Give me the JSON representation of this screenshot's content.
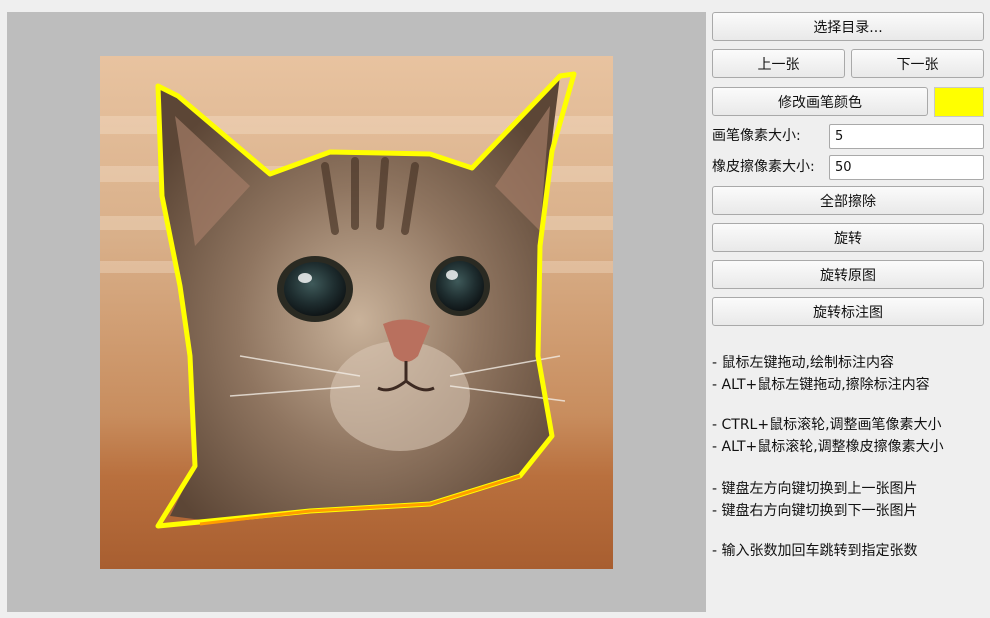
{
  "buttons": {
    "select_dir": "选择目录...",
    "prev": "上一张",
    "next": "下一张",
    "change_pen_color": "修改画笔颜色",
    "clear_all": "全部擦除",
    "rotate": "旋转",
    "rotate_original": "旋转原图",
    "rotate_annotation": "旋转标注图"
  },
  "pen_color": "#ffff00",
  "fields": {
    "pen_size_label": "画笔像素大小:",
    "pen_size_value": "5",
    "eraser_size_label": "橡皮擦像素大小:",
    "eraser_size_value": "50"
  },
  "help": {
    "line1": "- 鼠标左键拖动,绘制标注内容",
    "line2": "- ALT+鼠标左键拖动,擦除标注内容",
    "line3": "- CTRL+鼠标滚轮,调整画笔像素大小",
    "line4": "- ALT+鼠标滚轮,调整橡皮擦像素大小",
    "line5": "- 键盘左方向键切换到上一张图片",
    "line6": "- 键盘右方向键切换到下一张图片",
    "line7": "- 输入张数加回车跳转到指定张数"
  }
}
